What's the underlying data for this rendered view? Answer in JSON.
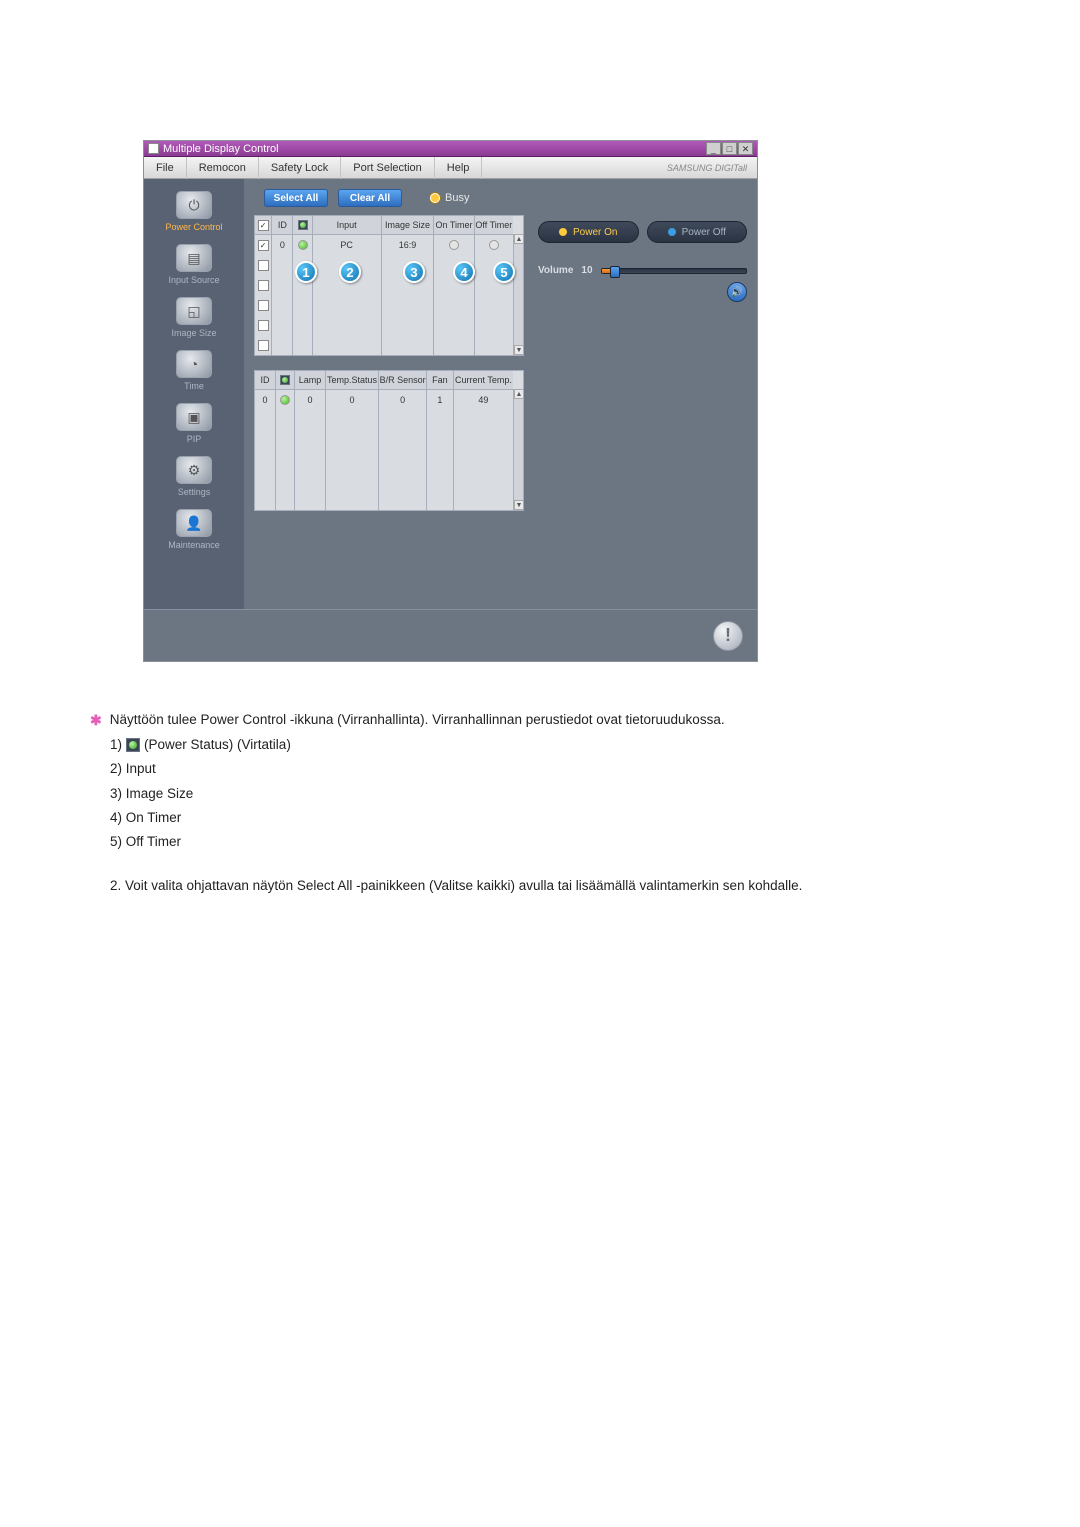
{
  "window": {
    "title": "Multiple Display Control",
    "brand": "SAMSUNG DIGITall"
  },
  "menu": {
    "items": [
      "File",
      "Remocon",
      "Safety Lock",
      "Port Selection",
      "Help"
    ]
  },
  "sidebar": {
    "items": [
      {
        "label": "Power Control",
        "active": true,
        "iconGlyph": "⏻"
      },
      {
        "label": "Input Source",
        "active": false,
        "iconGlyph": "▤"
      },
      {
        "label": "Image Size",
        "active": false,
        "iconGlyph": "◱"
      },
      {
        "label": "Time",
        "active": false,
        "iconGlyph": "◔"
      },
      {
        "label": "PIP",
        "active": false,
        "iconGlyph": "▣"
      },
      {
        "label": "Settings",
        "active": false,
        "iconGlyph": "⚙"
      },
      {
        "label": "Maintenance",
        "active": false,
        "iconGlyph": "👤"
      }
    ]
  },
  "actions": {
    "selectAll": "Select All",
    "clearAll": "Clear All",
    "busy": "Busy"
  },
  "grid1": {
    "headers": {
      "check": "",
      "id": "ID",
      "status": "",
      "input": "Input",
      "imageSize": "Image Size",
      "onTimer": "On Timer",
      "offTimer": "Off Timer"
    },
    "row": {
      "checked": true,
      "id": "0",
      "statusClass": "status-green",
      "input": "PC",
      "imageSize": "16:9",
      "onTimer": "○",
      "offTimer": "○"
    },
    "blankRows": 5
  },
  "grid2": {
    "headers": {
      "id": "ID",
      "status": "",
      "lamp": "Lamp",
      "tempStatus": "Temp.Status",
      "brSensor": "B/R Sensor",
      "fan": "Fan",
      "currentTemp": "Current Temp."
    },
    "row": {
      "id": "0",
      "statusClass": "status-green",
      "lamp": "0",
      "tempStatus": "0",
      "brSensor": "0",
      "fan": "1",
      "currentTemp": "49"
    },
    "blankRows": 5
  },
  "callouts": {
    "1": "1",
    "2": "2",
    "3": "3",
    "4": "4",
    "5": "5"
  },
  "rightPanel": {
    "powerOn": "Power On",
    "powerOff": "Power Off",
    "volumeLabel": "Volume",
    "volumeValue": "10"
  },
  "docText": {
    "intro": "Näyttöön tulee Power Control -ikkuna (Virranhallinta). Virranhallinnan perustiedot ovat tietoruudukossa.",
    "listItems": {
      "l1_prefix": "1)",
      "l1_suffix": "(Power Status) (Virtatila)",
      "l2": "2) Input",
      "l3": "3) Image Size",
      "l4": "4) On Timer",
      "l5": "5) Off Timer"
    },
    "paragraph2": "2.   Voit valita ohjattavan näytön Select All -painikkeen (Valitse kaikki) avulla tai lisäämällä valintamerkin sen kohdalle."
  }
}
